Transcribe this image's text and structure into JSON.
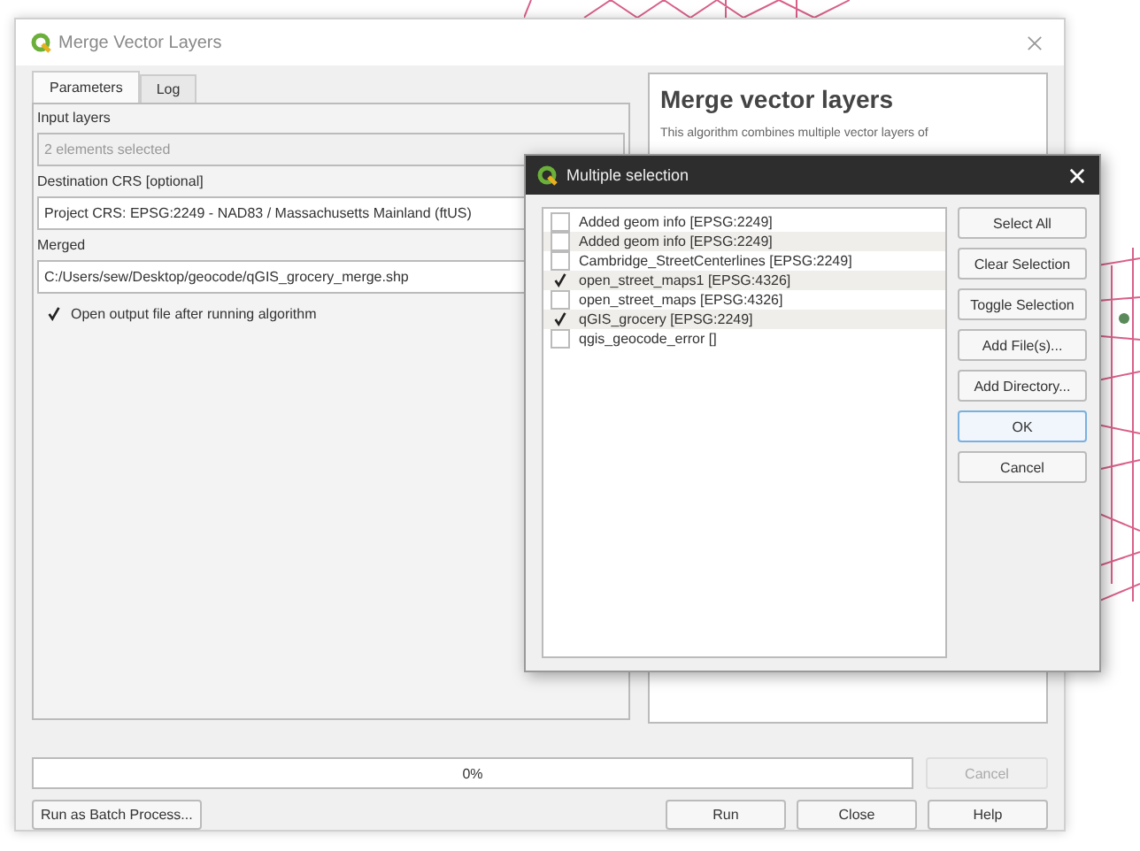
{
  "window": {
    "title": "Merge Vector Layers"
  },
  "tabs": [
    {
      "label": "Parameters",
      "selected": true
    },
    {
      "label": "Log",
      "selected": false
    }
  ],
  "parameters": [
    {
      "kind": "label",
      "text": "Input layers"
    },
    {
      "kind": "readonly",
      "value": "2 elements selected"
    },
    {
      "kind": "label",
      "text": "Destination CRS [optional]"
    },
    {
      "kind": "combo",
      "value": "Project CRS: EPSG:2249 - NAD83 / Massachusetts Mainland (ftUS)"
    },
    {
      "kind": "label",
      "text": "Merged"
    },
    {
      "kind": "field",
      "value": "C:/Users/sew/Desktop/geocode/qGIS_grocery_merge.shp"
    },
    {
      "kind": "checkbox",
      "text": "Open output file after running algorithm",
      "checked": true
    }
  ],
  "help": {
    "title": "Merge vector layers",
    "text": "This algorithm combines multiple vector layers of"
  },
  "progress": {
    "reading": "0%"
  },
  "cancel_button": {
    "label": "Cancel",
    "disabled": true
  },
  "batch_button": "Run as Batch Process...",
  "buttons": [
    "Run",
    "Close",
    "Help"
  ],
  "popup": {
    "title": "Multiple selection",
    "items": [
      {
        "label": "Added geom info [EPSG:2249]",
        "checked": false
      },
      {
        "label": "Added geom info [EPSG:2249]",
        "checked": false
      },
      {
        "label": "Cambridge_StreetCenterlines [EPSG:2249]",
        "checked": false
      },
      {
        "label": "open_street_maps1 [EPSG:4326]",
        "checked": true
      },
      {
        "label": "open_street_maps [EPSG:4326]",
        "checked": false
      },
      {
        "label": "qGIS_grocery [EPSG:2249]",
        "checked": true
      },
      {
        "label": "qgis_geocode_error []",
        "checked": false
      }
    ],
    "buttons": [
      {
        "label": "Select All",
        "default": false
      },
      {
        "label": "Clear Selection",
        "default": false
      },
      {
        "label": "Toggle Selection",
        "default": false
      },
      {
        "label": "Add File(s)...",
        "default": false
      },
      {
        "label": "Add Directory...",
        "default": false
      },
      {
        "label": "OK",
        "default": true
      },
      {
        "label": "Cancel",
        "default": false
      }
    ]
  }
}
